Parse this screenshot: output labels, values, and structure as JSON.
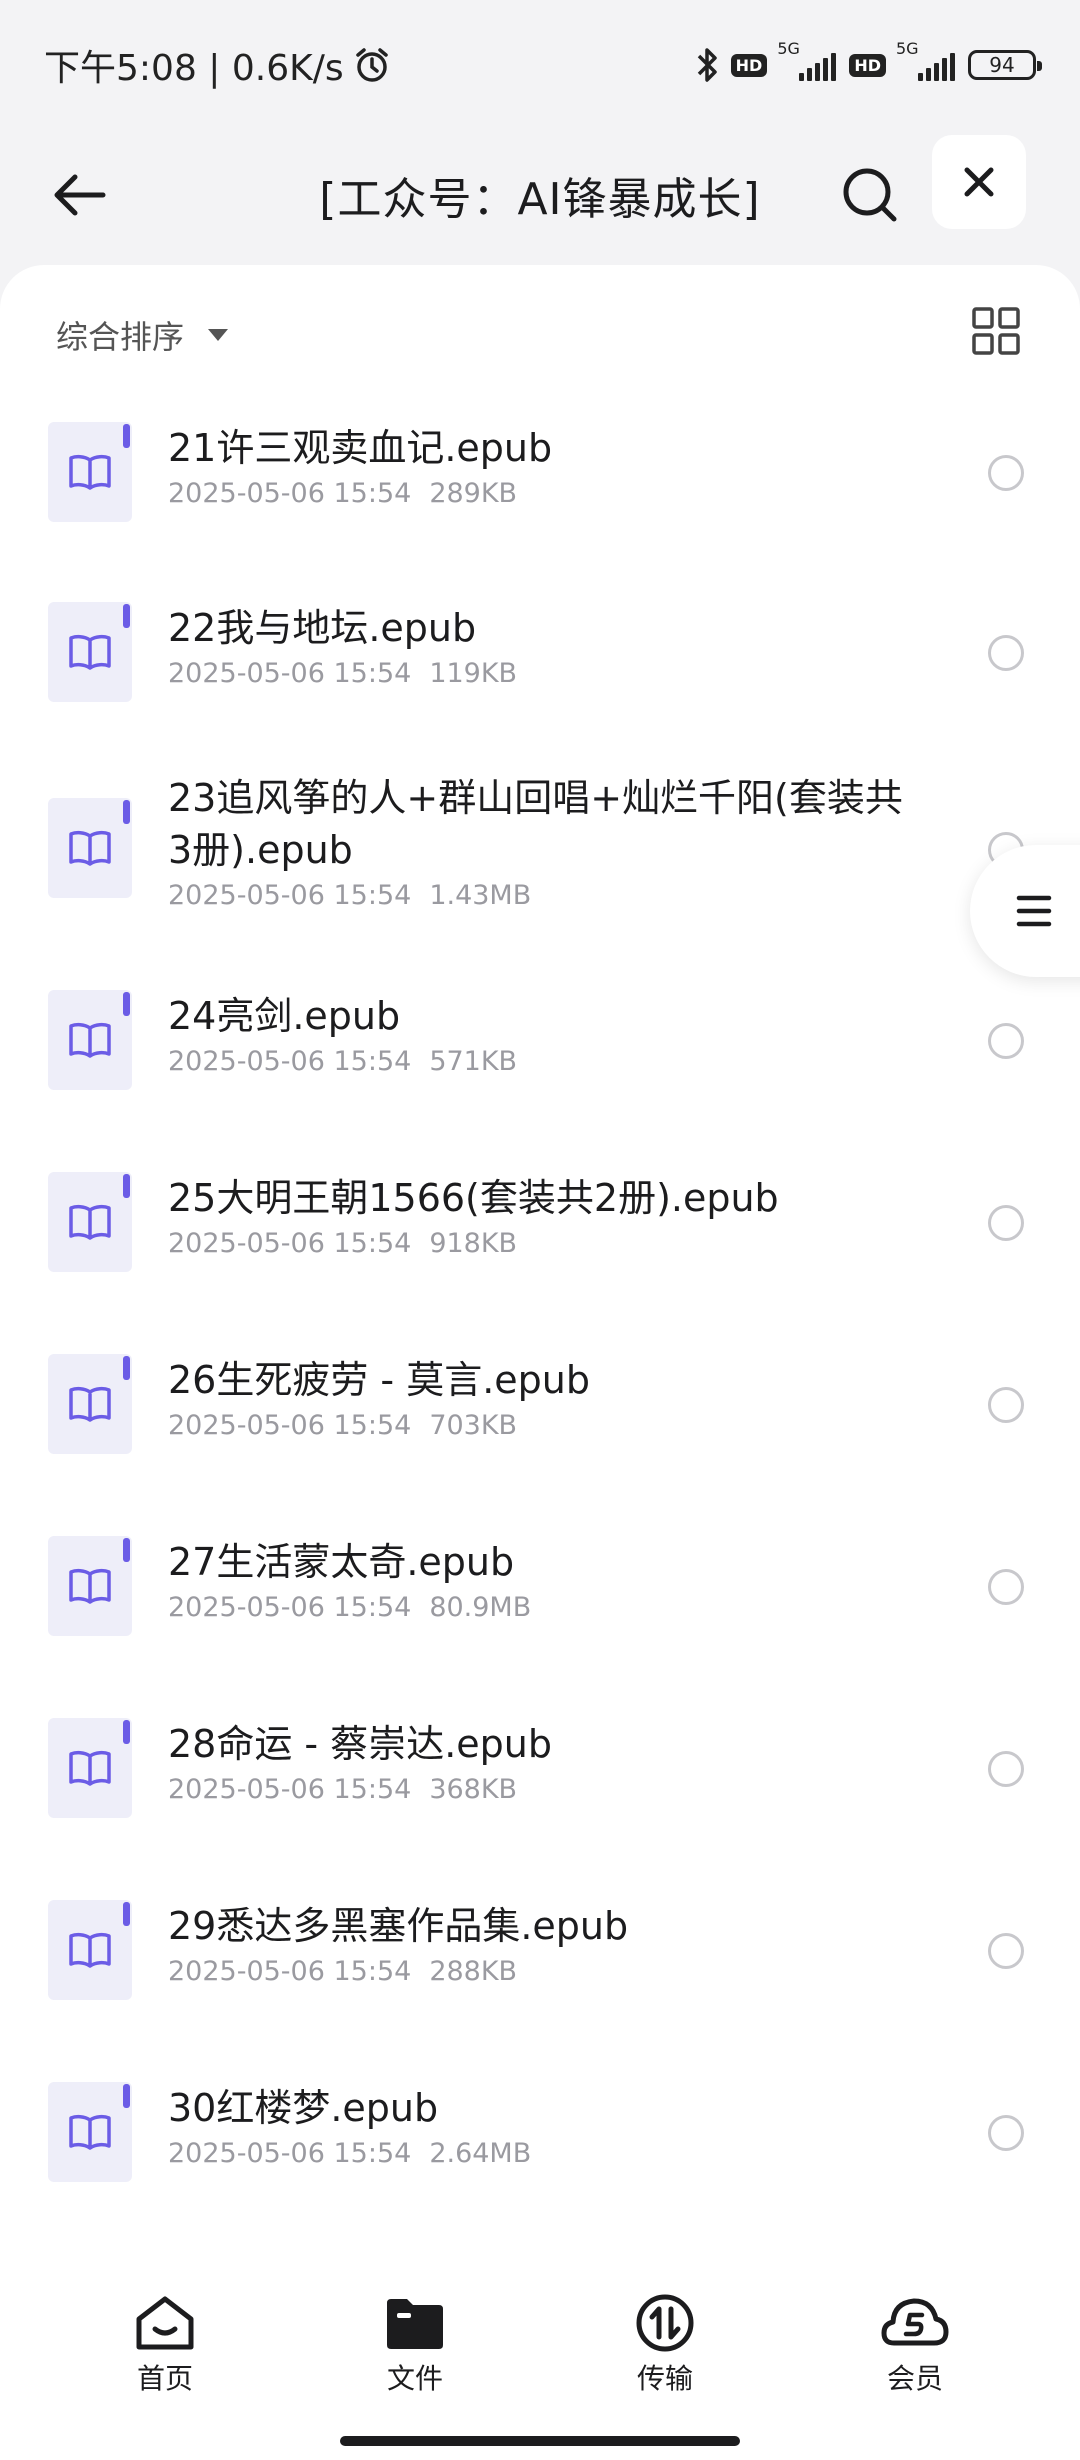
{
  "status_bar": {
    "time": "下午5:08 | 0.6K/s",
    "network_1": "5G",
    "network_2": "5G",
    "hd_1": "HD",
    "hd_2": "HD",
    "battery": "94"
  },
  "header": {
    "title": "[工众号：AI锋暴成长]"
  },
  "toolbar": {
    "sort_label": "综合排序"
  },
  "files": [
    {
      "name": "21许三观卖血记.epub",
      "date": "2025-05-06 15:54",
      "size": "289KB"
    },
    {
      "name": "22我与地坛.epub",
      "date": "2025-05-06 15:54",
      "size": "119KB"
    },
    {
      "name": "23追风筝的人+群山回唱+灿烂千阳(套装共3册).epub",
      "date": "2025-05-06 15:54",
      "size": "1.43MB"
    },
    {
      "name": "24亮剑.epub",
      "date": "2025-05-06 15:54",
      "size": "571KB"
    },
    {
      "name": "25大明王朝1566(套装共2册).epub",
      "date": "2025-05-06 15:54",
      "size": "918KB"
    },
    {
      "name": "26生死疲劳 - 莫言.epub",
      "date": "2025-05-06 15:54",
      "size": "703KB"
    },
    {
      "name": "27生活蒙太奇.epub",
      "date": "2025-05-06 15:54",
      "size": "80.9MB"
    },
    {
      "name": "28命运 - 蔡崇达.epub",
      "date": "2025-05-06 15:54",
      "size": "368KB"
    },
    {
      "name": "29悉达多黑塞作品集.epub",
      "date": "2025-05-06 15:54",
      "size": "288KB"
    },
    {
      "name": "30红楼梦.epub",
      "date": "2025-05-06 15:54",
      "size": "2.64MB"
    }
  ],
  "nav": {
    "items": [
      {
        "label": "首页",
        "icon": "home-icon"
      },
      {
        "label": "文件",
        "icon": "folder-icon"
      },
      {
        "label": "传输",
        "icon": "transfer-icon"
      },
      {
        "label": "会员",
        "icon": "vip-icon"
      }
    ],
    "active": "文件"
  },
  "colors": {
    "accent": "#6b5ce6",
    "icon_bg": "#eeeef9",
    "meta_text": "#9a9aa0"
  }
}
